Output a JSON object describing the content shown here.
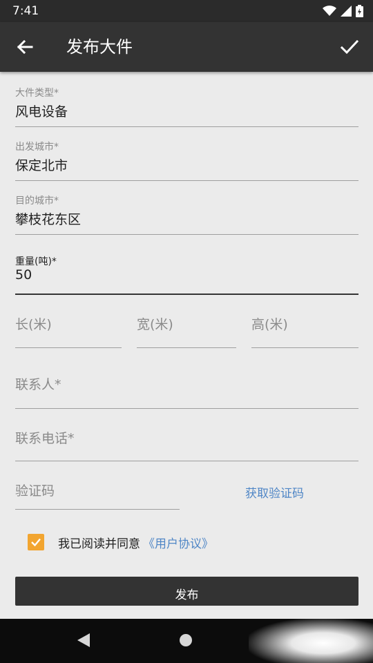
{
  "status_bar": {
    "time": "7:41"
  },
  "app_bar": {
    "title": "发布大件"
  },
  "form": {
    "cargo_type": {
      "label": "大件类型*",
      "value": "风电设备"
    },
    "origin_city": {
      "label": "出发城市*",
      "value": "保定北市"
    },
    "destination_city": {
      "label": "目的城市*",
      "value": "攀枝花东区"
    },
    "weight": {
      "label": "重量(吨)*",
      "value": "50"
    },
    "length": {
      "placeholder": "长(米)"
    },
    "width": {
      "placeholder": "宽(米)"
    },
    "height": {
      "placeholder": "高(米)"
    },
    "contact_name": {
      "placeholder": "联系人*"
    },
    "contact_phone": {
      "placeholder": "联系电话*"
    },
    "verification_code": {
      "placeholder": "验证码"
    },
    "get_code_label": "获取验证码"
  },
  "agreement": {
    "text": "我已阅读并同意",
    "link": "《用户协议》",
    "checked": true
  },
  "publish_label": "发布",
  "colors": {
    "app_bar": "#333333",
    "accent_link": "#4f86c6",
    "checkbox": "#f2a530",
    "background": "#ebebeb"
  },
  "icons": [
    "wifi-icon",
    "signal-icon",
    "battery-icon",
    "back-arrow-icon",
    "check-icon",
    "nav-back-icon",
    "nav-home-icon"
  ]
}
